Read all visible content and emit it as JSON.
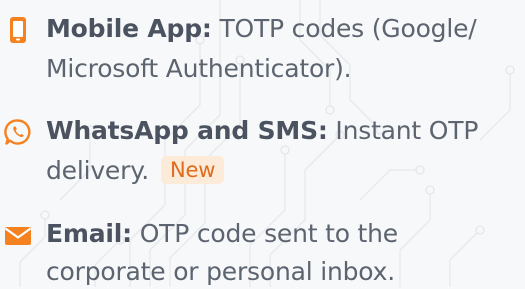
{
  "colors": {
    "accent": "#f58220",
    "text": "#5c6470",
    "heading": "#4b5260",
    "badge_bg": "#fdebd9",
    "badge_text": "#e06b1d"
  },
  "items": [
    {
      "icon": "mobile-phone-icon",
      "title": "Mobile App:",
      "line1": "TOTP codes (Google/",
      "line2": "Microsoft Authenticator)."
    },
    {
      "icon": "whatsapp-icon",
      "title": "WhatsApp and SMS:",
      "line1": "Instant OTP",
      "line2": "delivery.",
      "badge": "New"
    },
    {
      "icon": "envelope-icon",
      "title": "Email:",
      "line1": "OTP code sent to the",
      "line2": "corporate or personal inbox."
    }
  ]
}
